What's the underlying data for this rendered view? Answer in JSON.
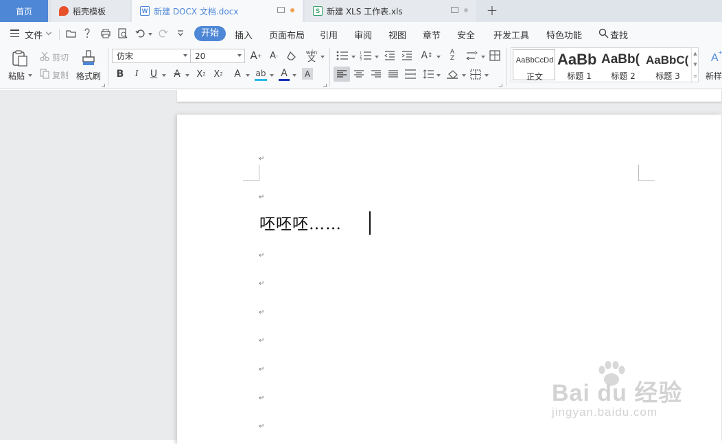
{
  "tabs": [
    {
      "label": "首页"
    },
    {
      "label": "稻壳模板"
    },
    {
      "label": "新建 DOCX 文档.docx"
    },
    {
      "label": "新建 XLS 工作表.xls"
    }
  ],
  "menu": {
    "file": "文件",
    "items": [
      "开始",
      "插入",
      "页面布局",
      "引用",
      "审阅",
      "视图",
      "章节",
      "安全",
      "开发工具",
      "特色功能"
    ],
    "search": "查找"
  },
  "ribbon": {
    "paste": "粘贴",
    "cut": "剪切",
    "copy": "复制",
    "format_painter": "格式刷",
    "font_name": "仿宋",
    "font_size": "20",
    "styles": [
      {
        "preview": "AaBbCcDd",
        "label": "正文"
      },
      {
        "preview": "AaBb",
        "label": "标题 1"
      },
      {
        "preview": "AaBb(",
        "label": "标题 2"
      },
      {
        "preview": "AaBbC(",
        "label": "标题 3"
      }
    ],
    "new_style": "新样"
  },
  "document": {
    "text": "呸呸呸……",
    "paragraph_mark": "↵"
  },
  "watermark": {
    "logo": "Bai du 经验",
    "url": "jingyan.baidu.com"
  },
  "colors": {
    "accent": "#4e87d6",
    "tab_dot_doc": "#f0a050",
    "font_color_underline": "#1a2fb8",
    "highlight_underline": "#2ab8e8"
  }
}
